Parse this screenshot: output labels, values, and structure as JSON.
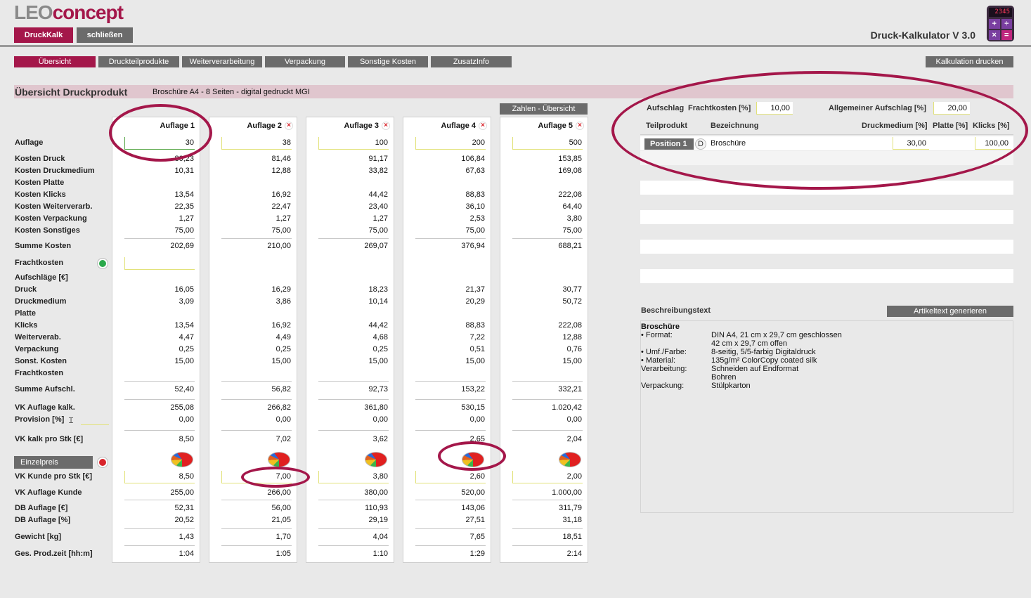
{
  "header": {
    "logo_leo": "LEO",
    "logo_concept": "concept",
    "btn_druckkalk": "DruckKalk",
    "btn_schliessen": "schließen",
    "app_title": "Druck-Kalkulator V 3.0",
    "calc_display": "2345",
    "calc_keys": [
      "+",
      "÷",
      "×",
      "="
    ]
  },
  "tabs": [
    "Übersicht",
    "Druckteilprodukte",
    "Weiterverarbeitung",
    "Verpackung",
    "Sonstige Kosten",
    "ZusatzInfo"
  ],
  "print_button": "Kalkulation drucken",
  "section": {
    "title": "Übersicht Druckprodukt",
    "description": "Broschüre A4 - 8 Seiten - digital gedruckt MGI"
  },
  "zahlen_button": "Zahlen - Übersicht",
  "column_headers": [
    "Auflage 1",
    "Auflage 2",
    "Auflage 3",
    "Auflage 4",
    "Auflage 5"
  ],
  "remove_icon": "×",
  "rows": {
    "auflage": {
      "label": "Auflage",
      "values": [
        "30",
        "38",
        "100",
        "200",
        "500"
      ]
    },
    "kosten_druck": {
      "label": "Kosten Druck",
      "values": [
        "80,23",
        "81,46",
        "91,17",
        "106,84",
        "153,85"
      ]
    },
    "kosten_druckmedium": {
      "label": "Kosten Druckmedium",
      "values": [
        "10,31",
        "12,88",
        "33,82",
        "67,63",
        "169,08"
      ]
    },
    "kosten_platte": {
      "label": "Kosten Platte",
      "values": [
        "",
        "",
        "",
        "",
        ""
      ]
    },
    "kosten_klicks": {
      "label": "Kosten Klicks",
      "values": [
        "13,54",
        "16,92",
        "44,42",
        "88,83",
        "222,08"
      ]
    },
    "kosten_weiterverarb": {
      "label": "Kosten Weiterverarb.",
      "values": [
        "22,35",
        "22,47",
        "23,40",
        "36,10",
        "64,40"
      ]
    },
    "kosten_verpackung": {
      "label": "Kosten Verpackung",
      "values": [
        "1,27",
        "1,27",
        "1,27",
        "2,53",
        "3,80"
      ]
    },
    "kosten_sonstiges": {
      "label": "Kosten Sonstiges",
      "values": [
        "75,00",
        "75,00",
        "75,00",
        "75,00",
        "75,00"
      ]
    },
    "summe_kosten": {
      "label": "Summe Kosten",
      "values": [
        "202,69",
        "210,00",
        "269,07",
        "376,94",
        "688,21"
      ]
    },
    "frachtkosten": {
      "label": "Frachtkosten"
    },
    "aufschlaege": {
      "label": "Aufschläge [€]"
    },
    "druck": {
      "label": "Druck",
      "values": [
        "16,05",
        "16,29",
        "18,23",
        "21,37",
        "30,77"
      ]
    },
    "druckmedium": {
      "label": "Druckmedium",
      "values": [
        "3,09",
        "3,86",
        "10,14",
        "20,29",
        "50,72"
      ]
    },
    "platte": {
      "label": "Platte"
    },
    "klicks": {
      "label": "Klicks",
      "values": [
        "13,54",
        "16,92",
        "44,42",
        "88,83",
        "222,08"
      ]
    },
    "weiterverab": {
      "label": "Weiterverab.",
      "values": [
        "4,47",
        "4,49",
        "4,68",
        "7,22",
        "12,88"
      ]
    },
    "verpackung": {
      "label": "Verpackung",
      "values": [
        "0,25",
        "0,25",
        "0,25",
        "0,51",
        "0,76"
      ]
    },
    "sonst_kosten": {
      "label": "Sonst. Kosten",
      "values": [
        "15,00",
        "15,00",
        "15,00",
        "15,00",
        "15,00"
      ]
    },
    "frachtkosten2": {
      "label": "Frachtkosten"
    },
    "summe_aufschl": {
      "label": "Summe Aufschl.",
      "values": [
        "52,40",
        "56,82",
        "92,73",
        "153,22",
        "332,21"
      ]
    },
    "vk_auflage_kalk": {
      "label": "VK Auflage kalk.",
      "values": [
        "255,08",
        "266,82",
        "361,80",
        "530,15",
        "1.020,42"
      ]
    },
    "provision": {
      "label": "Provision [%]",
      "values": [
        "0,00",
        "0,00",
        "0,00",
        "0,00",
        "0,00"
      ]
    },
    "vk_kalk_stk": {
      "label": "VK kalk pro Stk [€]",
      "values": [
        "8,50",
        "7,02",
        "3,62",
        "2,65",
        "2,04"
      ]
    },
    "einzelpreis": {
      "label": "Einzelpreis"
    },
    "vk_kunde_stk": {
      "label": "VK Kunde pro Stk [€]",
      "values": [
        "8,50",
        "7,00",
        "3,80",
        "2,60",
        "2,00"
      ]
    },
    "vk_auflage_kunde": {
      "label": "VK Auflage Kunde",
      "values": [
        "255,00",
        "266,00",
        "380,00",
        "520,00",
        "1.000,00"
      ]
    },
    "db_auflage_eur": {
      "label": "DB Auflage [€]",
      "values": [
        "52,31",
        "56,00",
        "110,93",
        "143,06",
        "311,79"
      ]
    },
    "db_auflage_pct": {
      "label": "DB Auflage [%]",
      "values": [
        "20,52",
        "21,05",
        "29,19",
        "27,51",
        "31,18"
      ]
    },
    "gewicht": {
      "label": "Gewicht [kg]",
      "values": [
        "1,43",
        "1,70",
        "4,04",
        "7,65",
        "18,51"
      ]
    },
    "prodzeit": {
      "label": "Ges. Prod.zeit [hh:m]",
      "values": [
        "1:04",
        "1:05",
        "1:10",
        "1:29",
        "2:14"
      ]
    }
  },
  "right_panel": {
    "aufschlag_label": "Aufschlag",
    "frachtkosten_label": "Frachtkosten [%]",
    "frachtkosten_value": "10,00",
    "allgemein_label": "Allgemeiner Aufschlag [%]",
    "allgemein_value": "20,00",
    "col_teilprodukt": "Teilprodukt",
    "col_bezeichnung": "Bezeichnung",
    "col_druckmedium": "Druckmedium [%]",
    "col_platte": "Platte [%]",
    "col_klicks": "Klicks [%]",
    "position": {
      "label": "Position 1",
      "type": "D",
      "name": "Broschüre",
      "druckmedium": "30,00",
      "klicks": "100,00"
    },
    "beschreibung_label": "Beschreibungstext",
    "artikeltext_button": "Artikeltext generieren",
    "desc": {
      "title": "Broschüre",
      "l1k": "• Format:",
      "l1v": "DIN A4, 21 cm x 29,7 cm geschlossen",
      "l2v": "42 cm x 29,7 cm offen",
      "l3k": "• Umf./Farbe:",
      "l3v": "8-seitig, 5/5-farbig Digitaldruck",
      "l4k": "• Material:",
      "l4v": "135g/m² ColorCopy coated silk",
      "l5k": "Verarbeitung:",
      "l5v": "Schneiden auf Endformat",
      "l6v": "Bohren",
      "l7k": "Verpackung:",
      "l7v": "Stülpkarton"
    }
  }
}
